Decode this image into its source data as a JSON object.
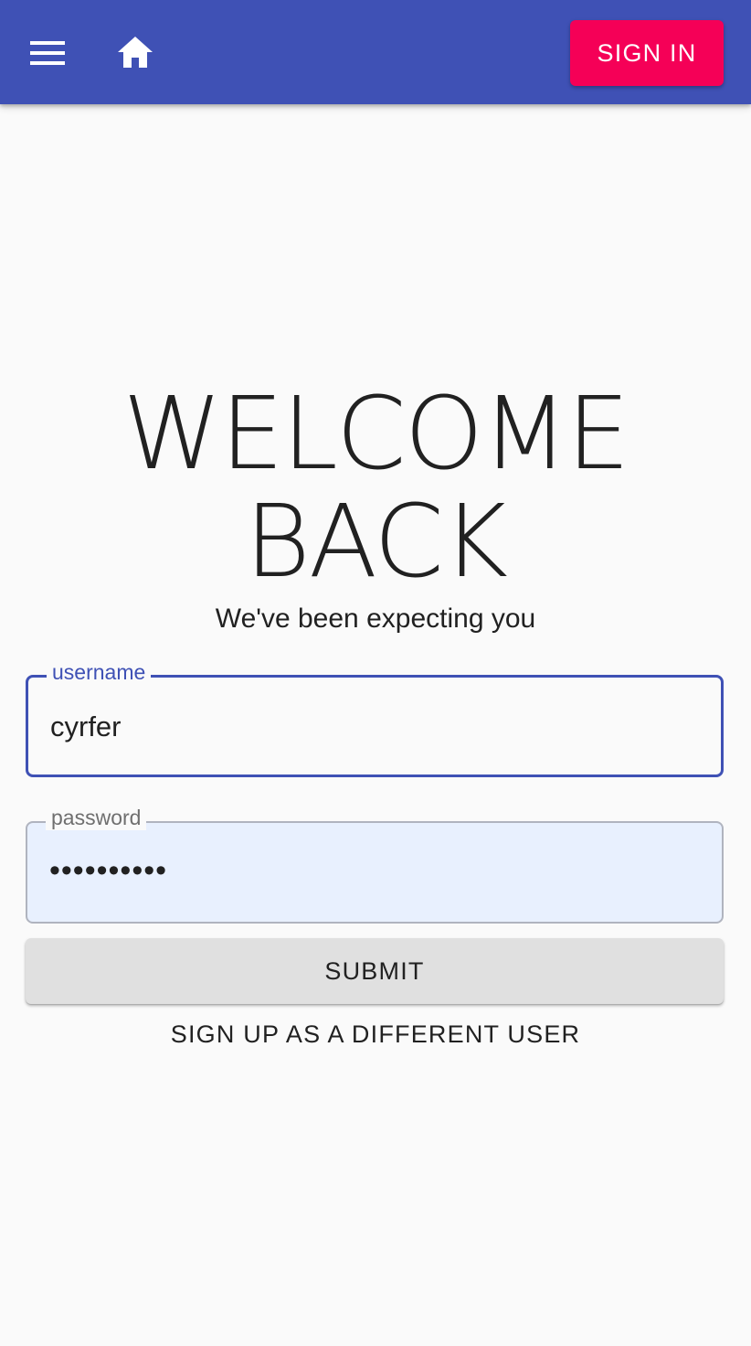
{
  "appbar": {
    "menu_icon": "hamburger-menu-icon",
    "home_icon": "home-icon",
    "signin_label": "SIGN IN",
    "background_color": "#3f51b5",
    "signin_color": "#f50057"
  },
  "main": {
    "title_line1": "WELCOME",
    "title_line2": "BACK",
    "subtitle": "We've been expecting you"
  },
  "form": {
    "username": {
      "label": "username",
      "value": "cyrfer"
    },
    "password": {
      "label": "password",
      "value": "••••••••••"
    },
    "submit_label": "SUBMIT",
    "signup_label": "SIGN UP AS A DIFFERENT USER"
  }
}
